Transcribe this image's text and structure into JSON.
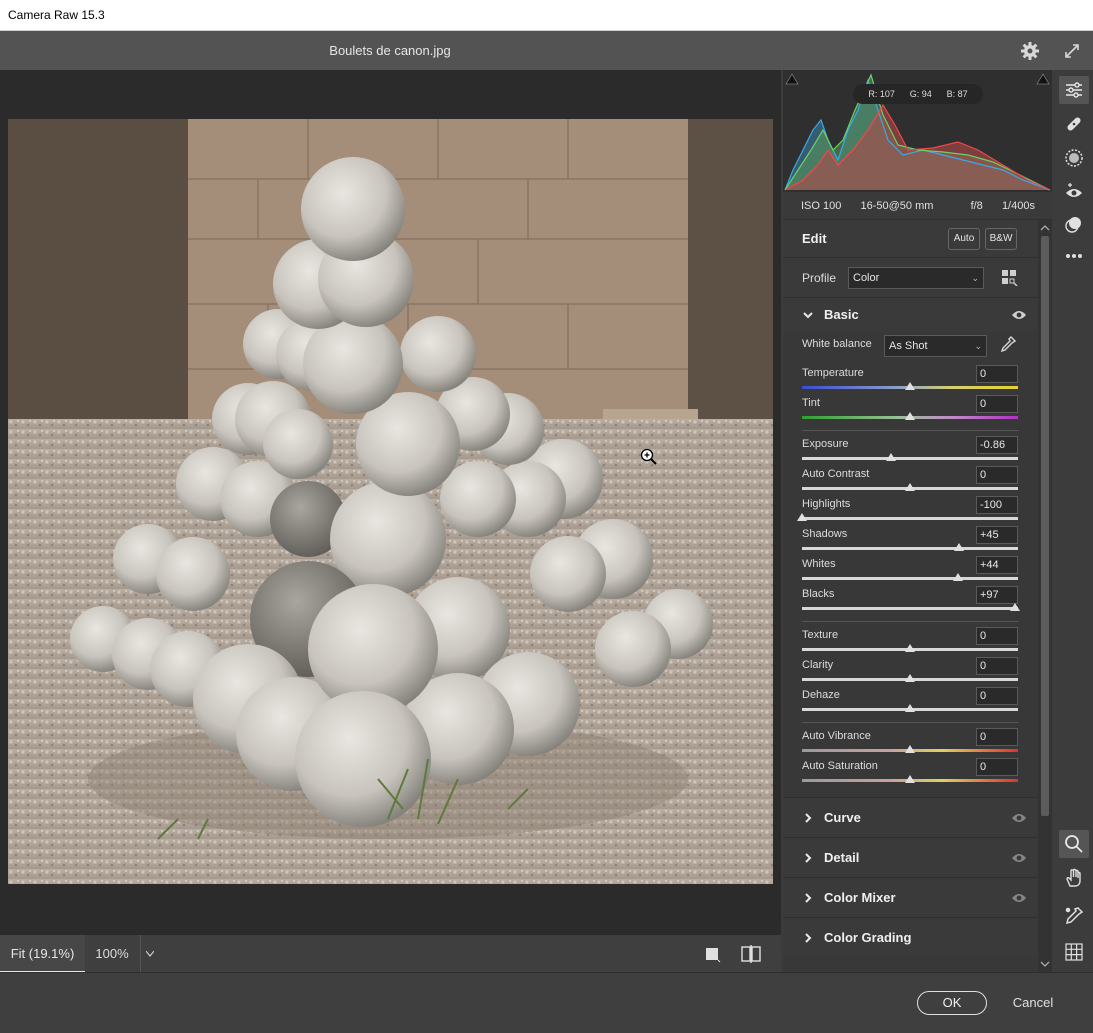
{
  "window": {
    "title": "Camera Raw 15.3"
  },
  "file": {
    "name": "Boulets de canon.jpg"
  },
  "icons": {
    "settings": "gear-icon",
    "fullscreen": "expand-icon"
  },
  "histogram": {
    "r_label": "R: 107",
    "g_label": "G: 94",
    "b_label": "B: 87"
  },
  "camera": {
    "iso": "ISO 100",
    "lens": "16-50@50 mm",
    "aperture": "f/8",
    "shutter": "1/400s"
  },
  "edit": {
    "title": "Edit",
    "auto_label": "Auto",
    "bw_label": "B&W"
  },
  "profile": {
    "label": "Profile",
    "value": "Color"
  },
  "basic": {
    "title": "Basic",
    "wb_label": "White balance",
    "wb_value": "As Shot",
    "sliders": [
      {
        "label": "Temperature",
        "value": "0",
        "pos": 0.5,
        "track": "temp"
      },
      {
        "label": "Tint",
        "value": "0",
        "pos": 0.5,
        "track": "tint"
      },
      {
        "label": "Exposure",
        "value": "-0.86",
        "pos": 0.414,
        "track": "plain"
      },
      {
        "label": "Auto Contrast",
        "value": "0",
        "pos": 0.5,
        "track": "plain"
      },
      {
        "label": "Highlights",
        "value": "-100",
        "pos": 0.0,
        "track": "plain"
      },
      {
        "label": "Shadows",
        "value": "+45",
        "pos": 0.725,
        "track": "plain"
      },
      {
        "label": "Whites",
        "value": "+44",
        "pos": 0.72,
        "track": "plain"
      },
      {
        "label": "Blacks",
        "value": "+97",
        "pos": 0.985,
        "track": "plain"
      },
      {
        "label": "Texture",
        "value": "0",
        "pos": 0.5,
        "track": "plain"
      },
      {
        "label": "Clarity",
        "value": "0",
        "pos": 0.5,
        "track": "plain"
      },
      {
        "label": "Dehaze",
        "value": "0",
        "pos": 0.5,
        "track": "plain"
      },
      {
        "label": "Auto Vibrance",
        "value": "0",
        "pos": 0.5,
        "track": "sat"
      },
      {
        "label": "Auto Saturation",
        "value": "0",
        "pos": 0.5,
        "track": "sat"
      }
    ]
  },
  "sections": {
    "curve": "Curve",
    "detail": "Detail",
    "color_mixer": "Color Mixer",
    "color_grading": "Color Grading"
  },
  "view": {
    "fit_label": "Fit (19.1%)",
    "zoom_label": "100%"
  },
  "footer": {
    "ok_label": "OK",
    "cancel_label": "Cancel"
  },
  "colors": {
    "panel_bg": "#383838",
    "canvas_bg": "#2b2b2b",
    "accent": "#e0e0e0"
  }
}
